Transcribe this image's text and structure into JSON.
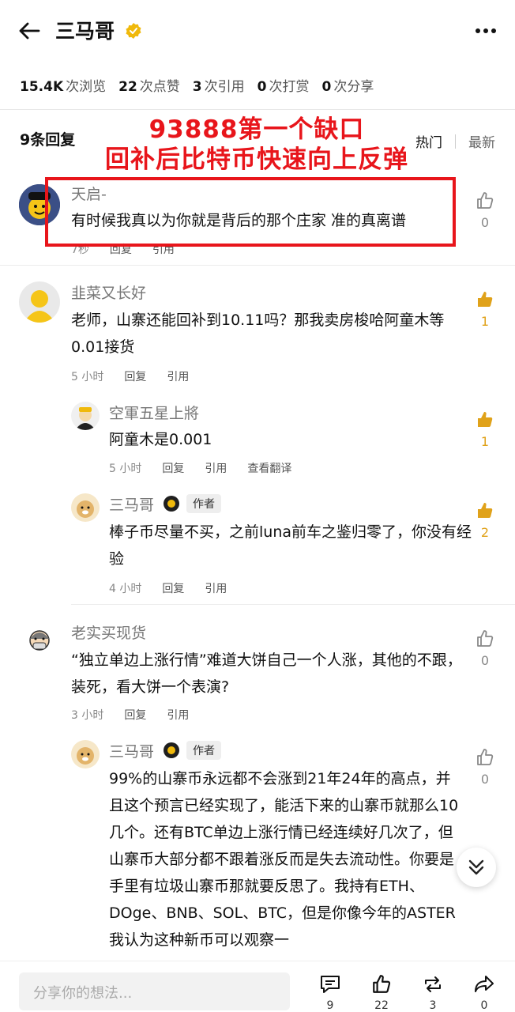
{
  "header": {
    "title": "三马哥"
  },
  "stats": [
    {
      "value": "15.4K",
      "label": "次浏览"
    },
    {
      "value": "22",
      "label": "次点赞"
    },
    {
      "value": "3",
      "label": "次引用"
    },
    {
      "value": "0",
      "label": "次打赏"
    },
    {
      "value": "0",
      "label": "次分享"
    }
  ],
  "replies": {
    "count_label": "9条回复",
    "sort_hot": "热门",
    "sort_new": "最新"
  },
  "overlay": {
    "line1": "93888第一个缺口",
    "line2": "回补后比特币快速向上反弹"
  },
  "comments": [
    {
      "name": "天启-",
      "text": "有时候我真以为你就是背后的那个庄家 准的真离谱",
      "time": "7秒",
      "reply": "回复",
      "quote": "引用",
      "likes": "0"
    },
    {
      "name": "韭菜又长好",
      "text": "老师，山寨还能回补到10.11吗？那我卖房梭哈阿童木等0.01接货",
      "time": "5 小时",
      "reply": "回复",
      "quote": "引用",
      "likes": "1"
    },
    {
      "name": "空軍五星上將",
      "text": "阿童木是0.001",
      "time": "5 小时",
      "reply": "回复",
      "quote": "引用",
      "translate": "查看翻译",
      "likes": "1"
    },
    {
      "name": "三马哥",
      "tag": "作者",
      "text": "棒子币尽量不买，之前luna前车之鉴归零了，你没有经验",
      "time": "4 小时",
      "reply": "回复",
      "quote": "引用",
      "likes": "2"
    },
    {
      "name": "老实买现货",
      "text": "“独立单边上涨行情”难道大饼自己一个人涨，其他的不跟，装死，看大饼一个表演?",
      "time": "3 小时",
      "reply": "回复",
      "quote": "引用",
      "likes": "0"
    },
    {
      "name": "三马哥",
      "tag": "作者",
      "text": "99%的山寨币永远都不会涨到21年24年的高点，并且这个预言已经实现了，能活下来的山寨币就那么10几个。还有BTC单边上涨行情已经连续好几次了，但山寨币大部分都不跟着涨反而是失去流动性。你要是手里有垃圾山寨币那就要反思了。我持有ETH、DOge、BNB、SOL、BTC，但是你像今年的ASTER我认为这种新币可以观察一",
      "likes": "0"
    }
  ],
  "bottom": {
    "placeholder": "分享你的想法...",
    "comments": "9",
    "likes": "22",
    "reposts": "3",
    "shares": "0"
  }
}
